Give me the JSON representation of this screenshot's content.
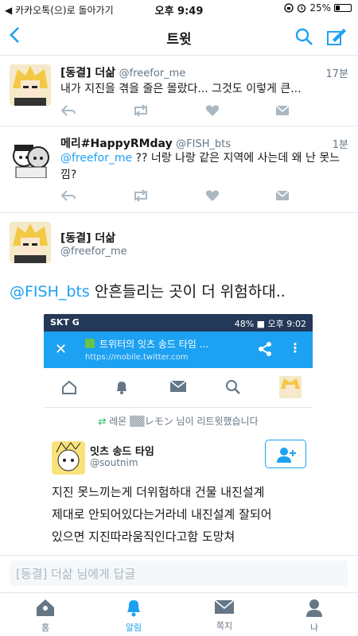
{
  "status_bar": {
    "back_app": "◀ 카카오톡(으)로 돌아가기",
    "time": "오후 9:49",
    "battery": "25%",
    "battery_level": 0.25
  },
  "nav": {
    "title": "트윗",
    "icons": [
      "back-chevron-icon",
      "search-icon",
      "compose-icon"
    ]
  },
  "tweets": [
    {
      "name": "[동결] 더삶",
      "handle": "@freefor_me",
      "time": "17분",
      "text": "내가 지진을 겪을 줄은 몰랐다... 그것도 이렇게 큰..."
    },
    {
      "name": "메리#HappyRMday",
      "handle": "@FISH_bts",
      "time": "1분",
      "mention": "@freefor_me",
      "text": " ?? 너랑 나랑 같은 지역에 사는데 왜 난 못느낌?",
      "text_line1_rest": " ?? 너랑 나랑 같은 지역에 사는데 왜 난 못느",
      "text_line2": "낌?"
    }
  ],
  "main_tweet": {
    "name": "[동결] 더삶",
    "handle": "@freefor_me",
    "mention": "@FISH_bts",
    "text": " 안흔들리는 곳이 더 위험하대.."
  },
  "embedded_screenshot": {
    "status_left": "SKT G",
    "status_right": "48% ■ 오후 9:02",
    "page_title": "트위터의 잇츠 송드 타임 ...",
    "url": "https://mobile.twitter.com",
    "retweet_line": "레몬 ▒▒レモン 님이 리트윗했습니다",
    "user_name": "잇츠 송드 타임",
    "user_handle": "@soutnim",
    "text_lines": [
      "지진 못느끼는게 더위험하대 건물 내진설계",
      "제대로 안되어있다는거라네 내진설계 잘되어",
      "있으면 지진따라움직인다고함 도망쳐"
    ]
  },
  "reply": {
    "placeholder": "[동결] 더삶 님에게 답글"
  },
  "tabbar": {
    "items": [
      {
        "label": "홈",
        "icon": "home-icon",
        "active": false
      },
      {
        "label": "알림",
        "icon": "bell-icon",
        "active": true
      },
      {
        "label": "쪽지",
        "icon": "mail-icon",
        "active": false
      },
      {
        "label": "나",
        "icon": "profile-icon",
        "active": false
      }
    ]
  },
  "colors": {
    "accent": "#1da1f2",
    "text": "#14171a",
    "muted": "#657786",
    "border": "#e1e8ed"
  }
}
